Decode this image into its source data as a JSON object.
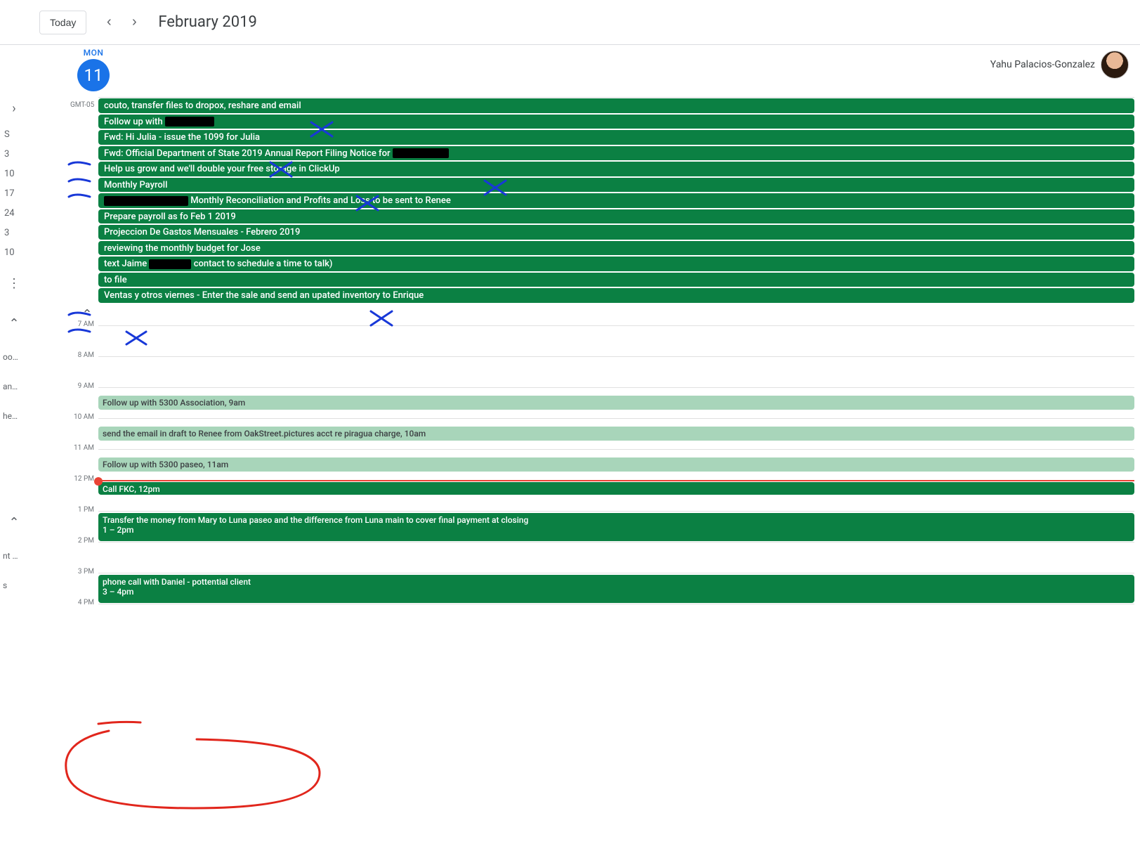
{
  "header": {
    "today_label": "Today",
    "month_title": "February 2019"
  },
  "owner": {
    "name": "Yahu Palacios-Gonzalez"
  },
  "day": {
    "weekday": "MON",
    "daynum": "11",
    "gmt": "GMT-05"
  },
  "left_rail": {
    "mini": [
      "S",
      "3",
      "10",
      "17",
      "24",
      "3",
      "10"
    ],
    "trunc": [
      "oo…",
      "an…",
      "he…",
      "nt …",
      "s"
    ]
  },
  "allday": [
    {
      "title": "couto, transfer files to dropox, reshare and email"
    },
    {
      "title_prefix": "Follow up with ",
      "redact_w": 70
    },
    {
      "title": "Fwd: Hi Julia - issue the 1099 for Julia"
    },
    {
      "title_prefix": "Fwd: Official Department of State 2019 Annual Report Filing Notice for ",
      "redact_w": 80
    },
    {
      "title": "Help us grow and we'll double your free storage in ClickUp"
    },
    {
      "title": "Monthly Payroll"
    },
    {
      "redact_w": 120,
      "title_suffix": " Monthly Reconciliation and Profits and Loss to be sent to Renee"
    },
    {
      "title": "Prepare payroll as fo Feb 1 2019"
    },
    {
      "title": "Projeccion De Gastos Mensuales - Febrero 2019"
    },
    {
      "title": "reviewing the monthly budget for Jose"
    },
    {
      "title_prefix": "text Jaime ",
      "redact_w": 60,
      "title_suffix": " contact to schedule a time to talk)"
    },
    {
      "title": "to file"
    },
    {
      "title": "Ventas y otros viernes - Enter the sale and send an upated inventory to Enrique"
    }
  ],
  "hours": [
    "7 AM",
    "8 AM",
    "9 AM",
    "10 AM",
    "11 AM",
    "12 PM",
    "1 PM",
    "2 PM",
    "3 PM",
    "4 PM"
  ],
  "timed": {
    "h9": {
      "title": "Follow up with 5300 Association",
      "time": "9am",
      "light": true
    },
    "h10": {
      "title": "send the email in draft to Renee from OakStreet.pictures acct re piragua charge",
      "time": "10am",
      "light": true
    },
    "h11": {
      "title": "Follow up with 5300 paseo",
      "time": "11am",
      "light": true
    },
    "h12": {
      "title": "Call FKC",
      "time": "12pm"
    },
    "h13": {
      "title": "Transfer the money from Mary to Luna paseo and the difference from Luna main to cover final payment at closing",
      "time": "1 – 2pm"
    },
    "h15": {
      "title": "phone call with Daniel - pottential client",
      "time": "3 – 4pm"
    }
  }
}
